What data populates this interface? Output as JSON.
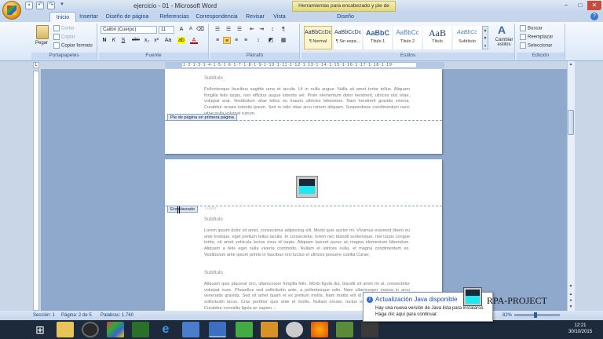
{
  "window": {
    "title": "ejercicio - 01 - Microsoft Word",
    "contextual_title": "Herramientas para encabezado y pie de página",
    "controls": [
      "−",
      "□",
      "✕"
    ]
  },
  "tabs": [
    "Inicio",
    "Insertar",
    "Diseño de página",
    "Referencias",
    "Correspondencia",
    "Revisar",
    "Vista",
    "Diseño"
  ],
  "active_tab": "Inicio",
  "ribbon": {
    "clipboard": {
      "label": "Portapapeles",
      "paste": "Pegar",
      "cut": "Cortar",
      "copy": "Copiar",
      "format_painter": "Copiar formato"
    },
    "font": {
      "label": "Fuente",
      "font_name": "Calibri (Cuerpo)",
      "font_size": "11",
      "buttons": [
        "N",
        "K",
        "S",
        "abe",
        "x₂",
        "x²",
        "Aa",
        "A"
      ]
    },
    "paragraph": {
      "label": "Párrafo"
    },
    "styles": {
      "label": "Estilos",
      "items": [
        {
          "preview": "AaBbCcDc",
          "name": "¶ Normal"
        },
        {
          "preview": "AaBbCcDc",
          "name": "¶ Sin espa..."
        },
        {
          "preview": "AaBbC",
          "name": "Título 1"
        },
        {
          "preview": "AaBbCc",
          "name": "Título 2"
        },
        {
          "preview": "AaB",
          "name": "Título"
        },
        {
          "preview": "AaBbCc",
          "name": "Subtítulo"
        }
      ],
      "change_styles": "Cambiar estilos"
    },
    "editing": {
      "label": "Edición",
      "find": "Buscar",
      "replace": "Reemplazar",
      "select": "Seleccionar"
    }
  },
  "document": {
    "page1": {
      "subtitle": "Subtítulo",
      "paragraph": "Pellentesque faucibus sagittis urna et iaculis. Ut in nulla augue. Nulla sit amet tortor tellus. Aliquam fringilla felis turpis, non efficitur augue lobortis vel. Proin elementum dolor hendrerit, ultrices nisl vitae, volutpat erat. Vestibulum vitae tellus eu mauris ultricies bibendum. Nam hendrerit gravida viverra. Curabitur ornare lobortis ipsum. Sed in odio vitae arcu rutrum aliquam. Suspendisse condimentum nunc vitae nulla volutpat rutrum.",
      "footer_label": "Pie de página en primera página"
    },
    "page2": {
      "header_label": "Encabezado",
      "title": "Título",
      "subtitle1": "Subtítulo",
      "paragraph1": "Lorem ipsum dolor sit amet, consectetur adipiscing elit. Morbi quis auctor mi. Vivamus euismod libero eu ante tristique, eget pretium tellus iaculis. In consectetur, lorem nec blandit scelerisque, nisl turpis congue tortor, sit amet vehicula lectus risus id turpis. Aliquam laoreet purus ac magna elementum bibendum. Aliquam a felis eget nulla viverra commodo. Nullam et ultrices nulla, et magna condimentum ex. Vestibulum ante ipsum primis in faucibus orci luctus et ultrices posuere cubilia Curae;",
      "subtitle2": "Subtítulo",
      "paragraph2": "Aliquam quis placerat orci, ullamcorper fringilla felis. Morbi ligula dui, blandit sit amet mi at, consectetur volutpat nunc. Phasellus sed sollicitudin ante, a pellentesque odio. Nam ullamcorper massa in arcu venenatis gravida. Sed sit amet quam et ex pretium mollis. Nam mattis elit id ornare mauris. Cras eu sollicitudin lacus. Cras porttitor quis ante et mollis. Nullam ornare, luctus est nec, placerat lectus. Curabitur convallis ligula ac sapien ..."
    }
  },
  "statusbar": {
    "section": "Sección: 1",
    "page": "Página: 2 de 5",
    "words": "Palabras: 1.760",
    "zoom": "82%"
  },
  "notification": {
    "title": "Actualización Java disponible",
    "line1": "Hay una nueva versión de Java lista para instalarse.",
    "line2": "Haga clic aquí para continuar."
  },
  "watermark": "RPA-PROJECT",
  "clock": {
    "time": "12:21",
    "date": "30/10/2015"
  },
  "colors": {
    "accent": "#15428b",
    "java_blue": "#2f6bd0",
    "cyan": "#1de8f0"
  }
}
